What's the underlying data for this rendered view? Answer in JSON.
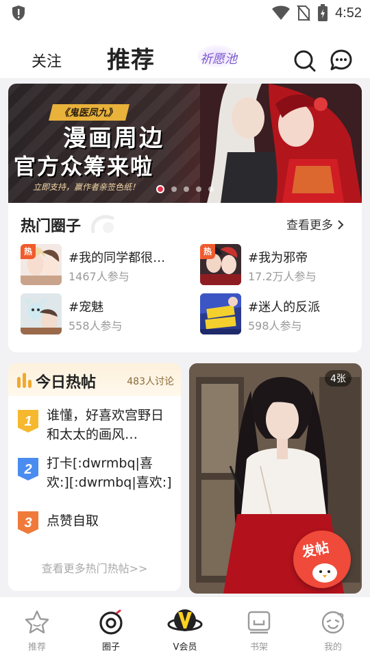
{
  "status_bar": {
    "time": "4:52"
  },
  "top_nav": {
    "tab_follow": "关注",
    "tab_recommend": "推荐",
    "wish_pool": "祈愿池"
  },
  "banner": {
    "tag": "《鬼医凤九》",
    "line1": "漫画周边",
    "line2": "官方众筹来啦",
    "sub": "立即支持，赢作者亲签色纸！",
    "active_slide": 1,
    "slide_count": 5
  },
  "hot_circles": {
    "title": "热门圈子",
    "see_more": "查看更多",
    "hot_badge": "热",
    "items": [
      {
        "name": "#我的同学都很…",
        "count": "1467人参与",
        "hot": true
      },
      {
        "name": "#我为邪帝",
        "count": "17.2万人参与",
        "hot": true
      },
      {
        "name": "#宠魅",
        "count": "558人参与",
        "hot": false
      },
      {
        "name": "#迷人的反派",
        "count": "598人参与",
        "hot": false
      }
    ]
  },
  "hot_posts": {
    "title": "今日热帖",
    "discussion": "483人讨论",
    "posts": [
      {
        "rank": "1",
        "text": "谁懂，好喜欢宫野日和太太的画风…",
        "color": "#f5b82e"
      },
      {
        "rank": "2",
        "text": "打卡[:dwrmbq|喜欢:][:dwrmbq|喜欢:]",
        "color": "#4a8cf0"
      },
      {
        "rank": "3",
        "text": "点赞自取",
        "color": "#f07a3a"
      }
    ],
    "more": "查看更多热门热帖>>"
  },
  "photo_card": {
    "badge": "4张",
    "post_button": "发帖"
  },
  "bottom_tabs": [
    {
      "label": "推荐",
      "icon": "star-icon",
      "active": false
    },
    {
      "label": "圈子",
      "icon": "vinyl-record-icon",
      "active": true
    },
    {
      "label": "V会员",
      "icon": "vip-planet-icon",
      "active": false
    },
    {
      "label": "书架",
      "icon": "bookshelf-icon",
      "active": false
    },
    {
      "label": "我的",
      "icon": "smiley-icon",
      "active": false
    }
  ],
  "colors": {
    "accent_red": "#e0344a",
    "hot_orange": "#f05b2d",
    "vip_yellow": "#ffd21f"
  }
}
